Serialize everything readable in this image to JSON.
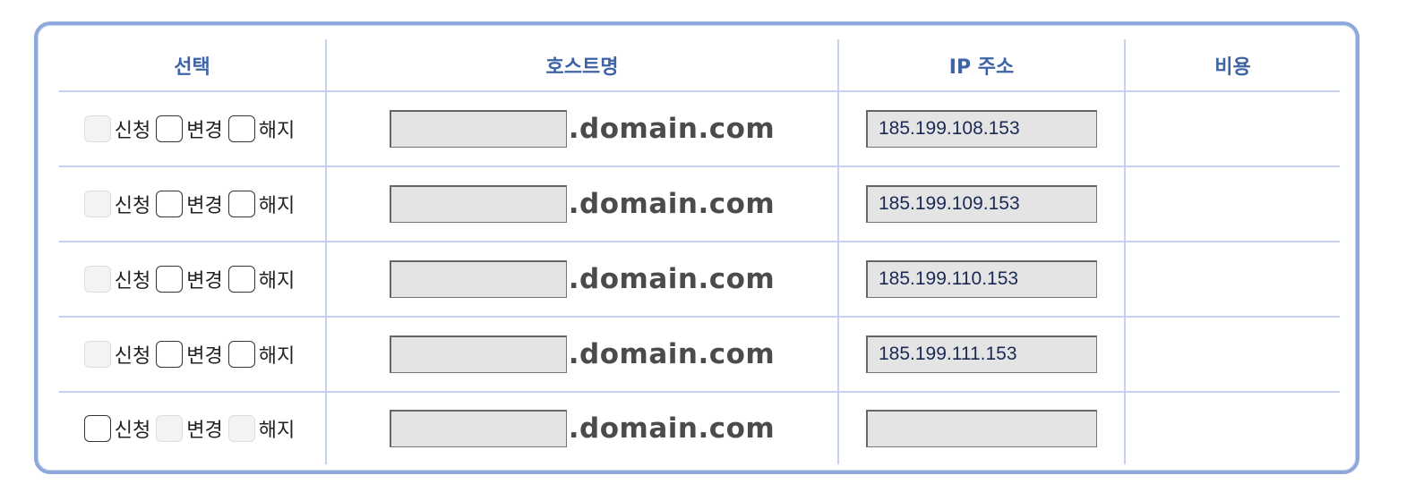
{
  "headers": {
    "select": "선택",
    "hostname": "호스트명",
    "ip": "IP 주소",
    "cost": "비용"
  },
  "options": {
    "apply": "신청",
    "change": "변경",
    "cancel": "해지"
  },
  "domain_suffix": ".domain.com",
  "rows": [
    {
      "hostname": "",
      "ip": "185.199.108.153",
      "cost": "",
      "apply_enabled": false,
      "change_enabled": true,
      "cancel_enabled": true
    },
    {
      "hostname": "",
      "ip": "185.199.109.153",
      "cost": "",
      "apply_enabled": false,
      "change_enabled": true,
      "cancel_enabled": true
    },
    {
      "hostname": "",
      "ip": "185.199.110.153",
      "cost": "",
      "apply_enabled": false,
      "change_enabled": true,
      "cancel_enabled": true
    },
    {
      "hostname": "",
      "ip": "185.199.111.153",
      "cost": "",
      "apply_enabled": false,
      "change_enabled": true,
      "cancel_enabled": true
    },
    {
      "hostname": "",
      "ip": "",
      "cost": "",
      "apply_enabled": true,
      "change_enabled": false,
      "cancel_enabled": false
    }
  ],
  "colors": {
    "header_text": "#3f63a4",
    "panel_border": "#8fa8db",
    "grid_line": "#c4d2ee",
    "input_bg": "#e4e4e4"
  }
}
